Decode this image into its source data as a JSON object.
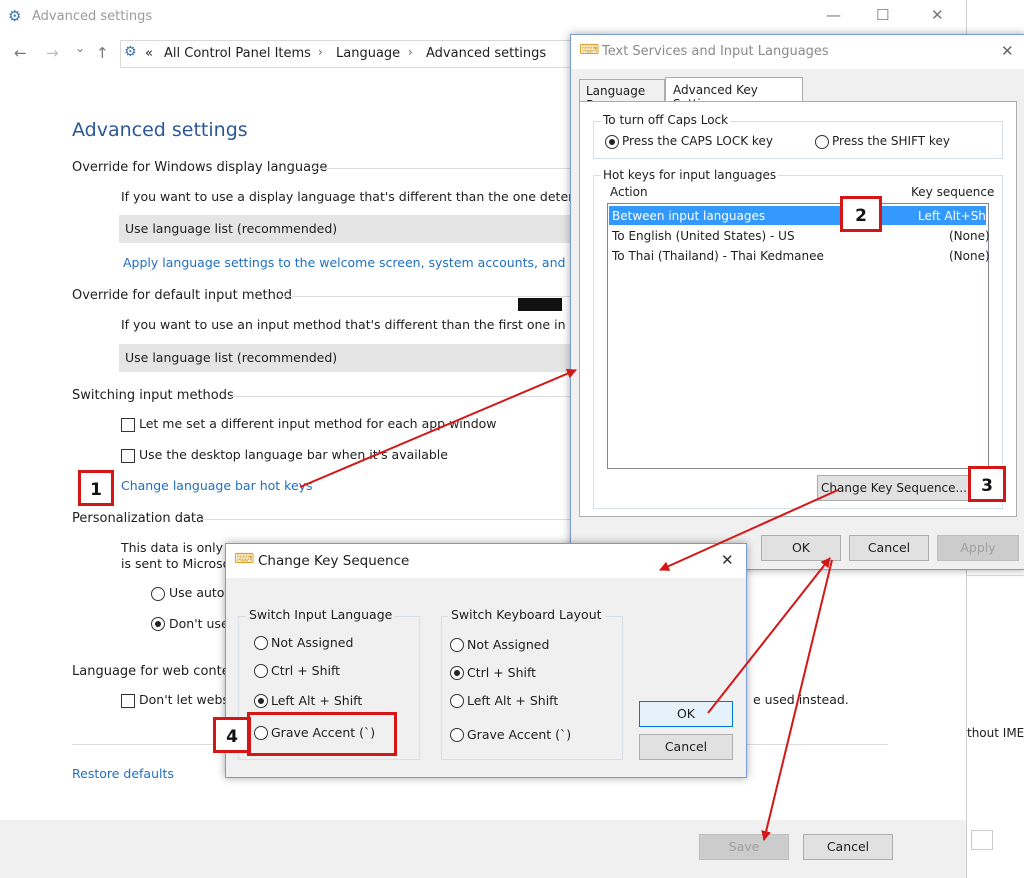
{
  "main_window": {
    "title": "Advanced settings",
    "controls": {
      "minimize": "—",
      "maximize": "☐",
      "close": "✕"
    },
    "nav": {
      "back": "←",
      "forward": "→",
      "recent": "⌄",
      "up": "↑"
    },
    "breadcrumb": {
      "overflow": "«",
      "items": [
        "All Control Panel Items",
        "Language",
        "Advanced settings"
      ],
      "separator": "›"
    },
    "heading": "Advanced settings",
    "sections": {
      "display_language": {
        "title": "Override for Windows display language",
        "text": "If you want to use a display language that's different than the one determined",
        "dropdown_value": "Use language list (recommended)",
        "link": "Apply language settings to the welcome screen, system accounts, and new us"
      },
      "input_method": {
        "title": "Override for default input method",
        "text": "If you want to use an input method that's different than the first one in your la",
        "dropdown_value": "Use language list (recommended)"
      },
      "switching": {
        "title": "Switching input methods",
        "checkbox1": "Let me set a different input method for each app window",
        "checkbox2": "Use the desktop language bar when it's available",
        "link": "Change language bar hot keys"
      },
      "personalization": {
        "title": "Personalization data",
        "text_line1": "This data is only u",
        "text_line2": "is sent to Microso",
        "radio1": "Use autor",
        "radio2": "Don't use"
      },
      "web_content": {
        "title": "Language for web content",
        "checkbox": "Don't let websi",
        "checkbox_tail": "e used instead."
      }
    },
    "restore_link": "Restore defaults",
    "buttons": {
      "save": "Save",
      "cancel": "Cancel"
    }
  },
  "right_partial": {
    "fragment": "thout IMEs"
  },
  "tsil_dialog": {
    "title": "Text Services and Input Languages",
    "close": "✕",
    "tabs": [
      "Language Bar",
      "Advanced Key Settings"
    ],
    "caps_group": {
      "title": "To turn off Caps Lock",
      "option1": "Press the CAPS LOCK key",
      "option2": "Press the SHIFT key"
    },
    "hotkeys_group": {
      "title": "Hot keys for input languages",
      "col_action": "Action",
      "col_key": "Key sequence",
      "rows": [
        {
          "action": "Between input languages",
          "key": "Left Alt+Shift"
        },
        {
          "action": "To English (United States) - US",
          "key": "(None)"
        },
        {
          "action": "To Thai (Thailand) - Thai Kedmanee",
          "key": "(None)"
        }
      ],
      "change_button": "Change Key Sequence..."
    },
    "buttons": {
      "ok": "OK",
      "cancel": "Cancel",
      "apply": "Apply"
    }
  },
  "cks_dialog": {
    "title": "Change Key Sequence",
    "close": "✕",
    "group_input": {
      "title": "Switch Input Language",
      "options": [
        "Not Assigned",
        "Ctrl + Shift",
        "Left Alt + Shift",
        "Grave Accent (`)"
      ]
    },
    "group_layout": {
      "title": "Switch Keyboard Layout",
      "options": [
        "Not Assigned",
        "Ctrl + Shift",
        "Left Alt + Shift",
        "Grave Accent (`)"
      ]
    },
    "buttons": {
      "ok": "OK",
      "cancel": "Cancel"
    }
  },
  "annotations": {
    "c1": "1",
    "c2": "2",
    "c3": "3",
    "c4": "4",
    "color": "#d41616"
  }
}
